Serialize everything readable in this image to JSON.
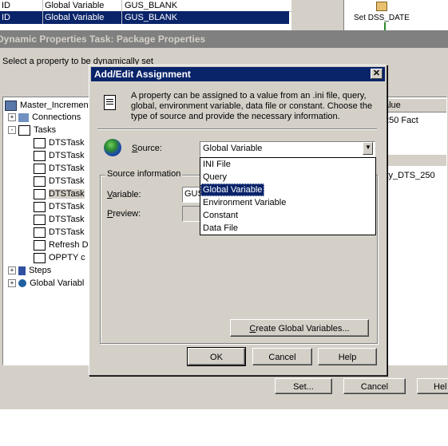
{
  "top_grid": {
    "rows": [
      {
        "c1": "ID",
        "c2": "Global Variable",
        "c3": "GUS_BLANK",
        "selected": false
      },
      {
        "c1": "ID",
        "c2": "Global Variable",
        "c3": "GUS_BLANK",
        "selected": true
      }
    ],
    "set_dss_label": "Set DSS_DATE"
  },
  "bg_window": {
    "title": "Dynamic Properties Task: Package Properties",
    "instruction": "Select a property to be dynamically set",
    "tree": {
      "root": "Master_Increment",
      "items": [
        {
          "label": "Connections",
          "level": 1,
          "toggle": "+"
        },
        {
          "label": "Tasks",
          "level": 1,
          "toggle": "-"
        },
        {
          "label": "DTSTask",
          "level": 2
        },
        {
          "label": "DTSTask",
          "level": 2
        },
        {
          "label": "DTSTask",
          "level": 2
        },
        {
          "label": "DTSTask",
          "level": 2
        },
        {
          "label": "DTSTask",
          "level": 2,
          "selected": true
        },
        {
          "label": "DTSTask",
          "level": 2
        },
        {
          "label": "DTSTask",
          "level": 2
        },
        {
          "label": "DTSTask",
          "level": 2
        },
        {
          "label": "Refresh D",
          "level": 2
        },
        {
          "label": "OPPTY c",
          "level": 2
        },
        {
          "label": "Steps",
          "level": 1,
          "toggle": "+"
        },
        {
          "label": "Global Variabl",
          "level": 1,
          "toggle": "+"
        }
      ]
    },
    "value_header": "alue",
    "value_row1": "250 Fact",
    "value_row2": "ity_DTS_250",
    "buttons": {
      "set": "Set...",
      "cancel": "Cancel",
      "help": "Hel"
    }
  },
  "dialog": {
    "title": "Add/Edit Assignment",
    "description": "A property can be assigned to a value from an .ini file, query, global, environment variable, data file or constant.  Choose the type of source and provide the necessary information.",
    "source_label": "Source:",
    "source_value": "Global Variable",
    "group_label": "Source information",
    "variable_label": "Variable:",
    "variable_value": "GUS",
    "preview_label": "Preview:",
    "dropdown_options": [
      "INI File",
      "Query",
      "Global Variable",
      "Environment Variable",
      "Constant",
      "Data File"
    ],
    "selected_option": "Global Variable",
    "create_button": "Create Global Variables...",
    "ok_button": "OK",
    "cancel_button": "Cancel",
    "help_button": "Help"
  }
}
